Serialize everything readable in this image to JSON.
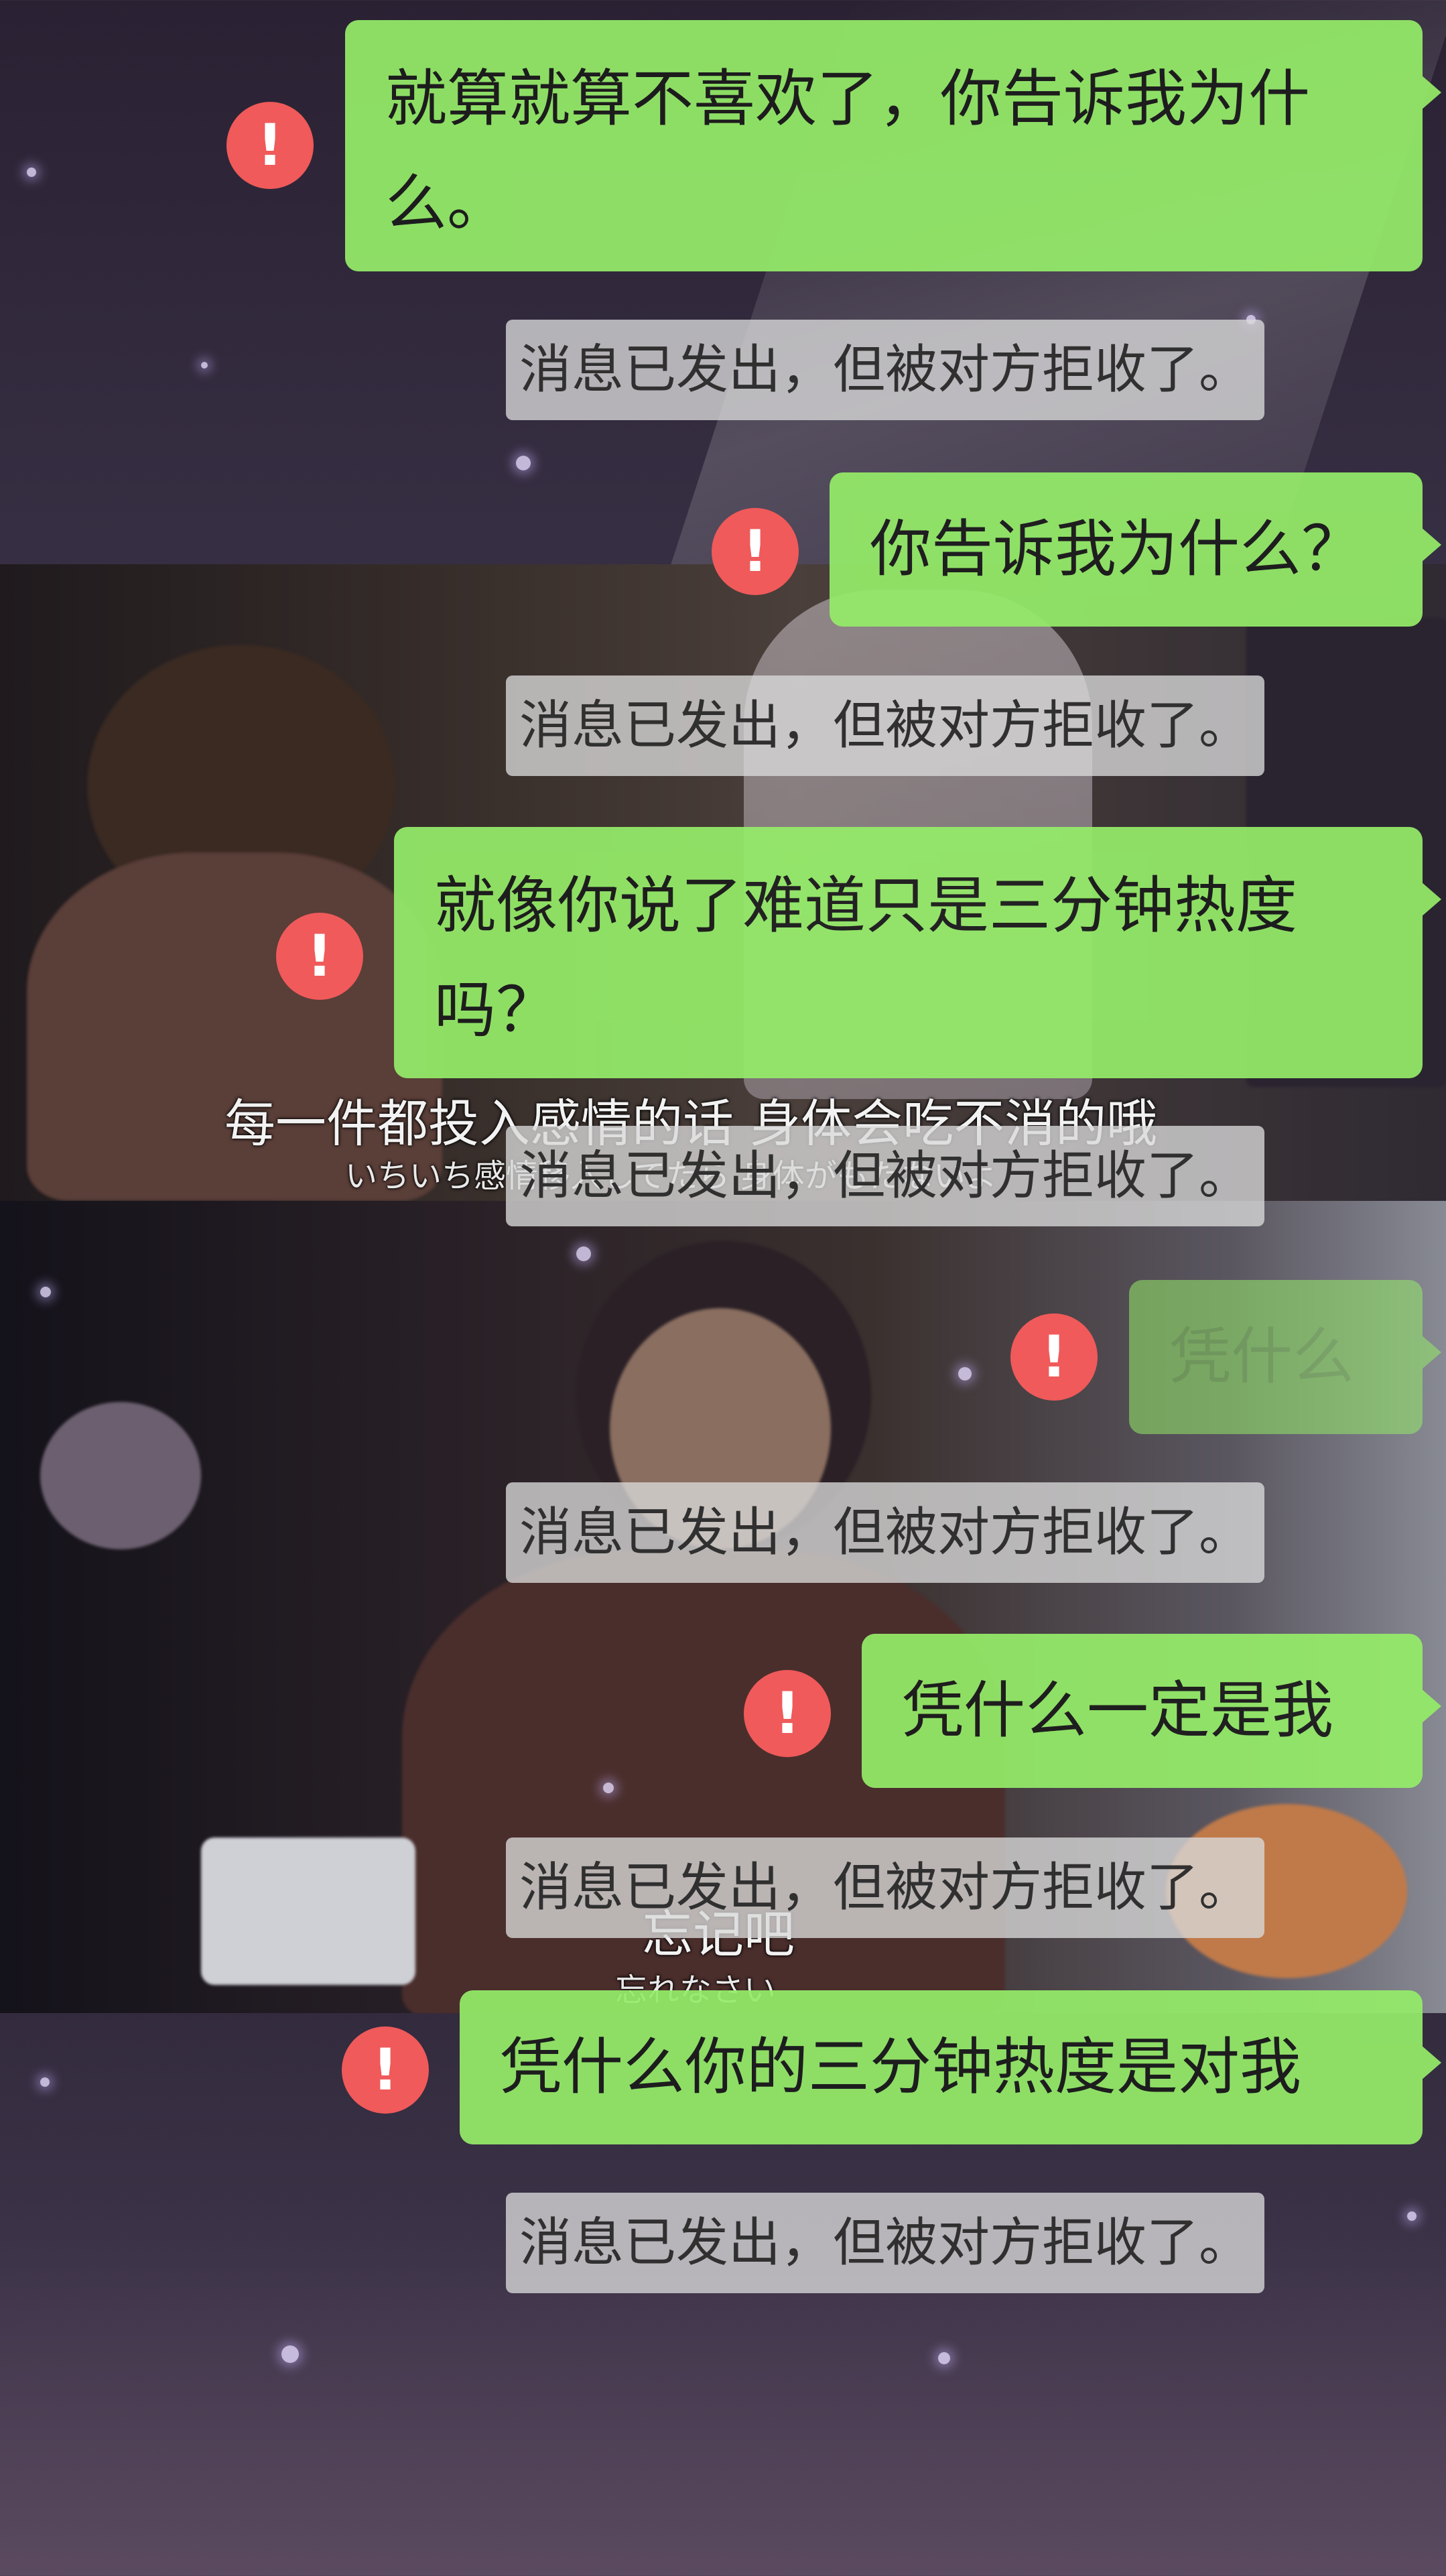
{
  "messages": [
    {
      "text": "就算就算不喜欢了，你告诉我为什么。",
      "status": "消息已发出，但被对方拒收了。"
    },
    {
      "text": "你告诉我为什么？",
      "status": "消息已发出，但被对方拒收了。"
    },
    {
      "text": "就像你说了难道只是三分钟热度吗？",
      "status": "消息已发出，但被对方拒收了。"
    },
    {
      "text": "凭什么",
      "status": "消息已发出，但被对方拒收了。"
    },
    {
      "text": "凭什么一定是我",
      "status": "消息已发出，但被对方拒收了。"
    },
    {
      "text": "凭什么你的三分钟热度是对我",
      "status": "消息已发出，但被对方拒收了。"
    }
  ],
  "subtitles": [
    {
      "zh": "每一件都投入感情的话 身体会吃不消的哦",
      "jp": "いちいち感情移入してたら 身体がもたないよ"
    },
    {
      "zh": "忘记吧",
      "jp": "忘れなさい"
    }
  ],
  "icons": {
    "send_failed": "exclamation-alert-icon"
  },
  "colors": {
    "bubble": "#95ec69",
    "alert": "#f05a5a",
    "notice_bg": "#dadada"
  }
}
